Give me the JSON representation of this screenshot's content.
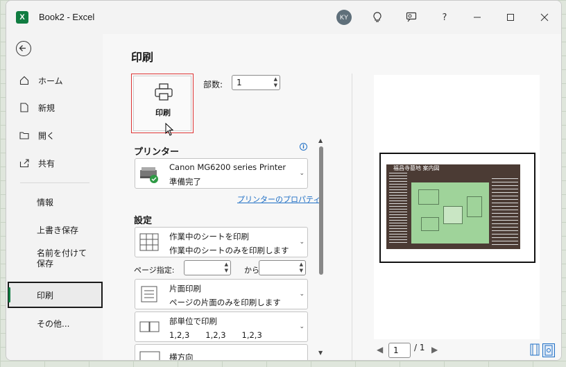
{
  "window": {
    "title": "Book2  -  Excel",
    "app_icon_letter": "X",
    "avatar_initials": "KY",
    "controls": {
      "help": "?",
      "minimize_icon": "minimize-icon",
      "maximize_icon": "maximize-icon",
      "close_icon": "close-icon"
    },
    "accent_color": "#107c41"
  },
  "nav": {
    "items": [
      {
        "label": "ホーム",
        "icon": "home-icon"
      },
      {
        "label": "新規",
        "icon": "new-document-icon"
      },
      {
        "label": "開く",
        "icon": "folder-open-icon"
      },
      {
        "label": "共有",
        "icon": "share-icon"
      },
      {
        "label": "情報"
      },
      {
        "label": "上書き保存"
      },
      {
        "label": "名前を付けて保存"
      },
      {
        "label": "印刷",
        "selected": true
      },
      {
        "label": "その他..."
      }
    ]
  },
  "print": {
    "heading": "印刷",
    "print_button_label": "印刷",
    "copies_label": "部数:",
    "copies_value": "1",
    "printer_section": "プリンター",
    "printer_name": "Canon MG6200 series Printer",
    "printer_status": "準備完了",
    "printer_properties_link": "プリンターのプロパティ",
    "settings_section": "設定",
    "what_to_print": {
      "line1": "作業中のシートを印刷",
      "line2": "作業中のシートのみを印刷します"
    },
    "pages_label": "ページ指定:",
    "pages_from": "",
    "pages_to_label": "から",
    "pages_to": "",
    "sides": {
      "line1": "片面印刷",
      "line2": "ページの片面のみを印刷します"
    },
    "collate": {
      "line1": "部単位で印刷",
      "line2": "1,2,3　　1,2,3　　1,2,3"
    },
    "orientation": {
      "line1": "横方向"
    }
  },
  "preview": {
    "current_page": "1",
    "total_pages": "/ 1",
    "sign_title": "福昌寺墓地 案内図"
  }
}
